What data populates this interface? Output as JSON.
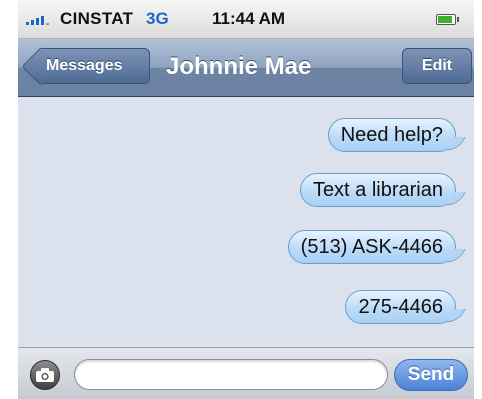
{
  "status_bar": {
    "carrier": "CINSTAT",
    "network": "3G",
    "time": "11:44 AM",
    "signal_bars": 4,
    "battery_level": 0.9,
    "colors": {
      "network": "#1f66c4",
      "battery": "#3fae2f"
    }
  },
  "nav": {
    "back_label": "Messages",
    "title": "Johnnie Mae",
    "edit_label": "Edit"
  },
  "messages": [
    {
      "text": "Need help?",
      "direction": "outgoing"
    },
    {
      "text": "Text a librarian",
      "direction": "outgoing"
    },
    {
      "text": "(513) ASK-4466",
      "direction": "outgoing"
    },
    {
      "text": "275-4466",
      "direction": "outgoing"
    }
  ],
  "compose": {
    "input_value": "",
    "send_label": "Send",
    "camera_icon": "camera-icon"
  }
}
